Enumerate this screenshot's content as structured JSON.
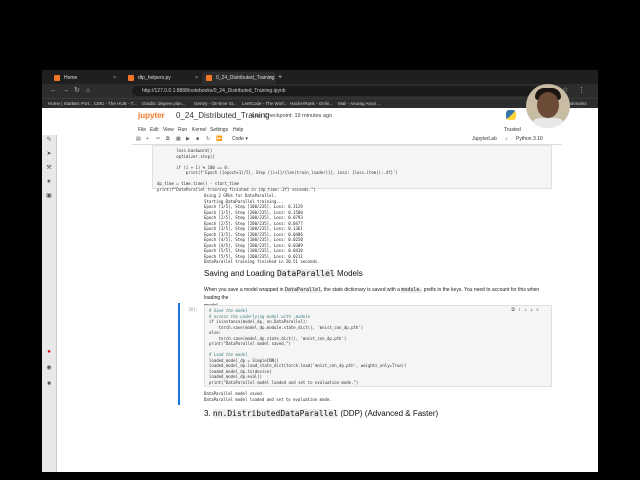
{
  "browser": {
    "tabs": [
      {
        "label": "Home",
        "color": "#f37726"
      },
      {
        "label": "dtp_helpers.py",
        "color": "#f37726"
      },
      {
        "label": "0_24_Distributed_Training",
        "color": "#f37726"
      }
    ],
    "new_tab_icon": "plus-icon",
    "url": "http://127.0.0.1:8888/notebooks/0_24_Distributed_Training.ipynb",
    "bookmarks": [
      "Home | StarBez Port...",
      "CMU - The HUB - T...",
      "Gradio: degree plan...",
      "Gentry - On-time St...",
      "LeetCode - The Worl...",
      "HackerRank - Onlin...",
      "Mail - Anurag Aryal ...",
      "All Bookmarks"
    ]
  },
  "jupyter": {
    "logo": "jupyter",
    "notebook_title": "0_24_Distributed_Training",
    "checkpoint": "Last Checkpoint: 19 minutes ago",
    "menu": [
      "File",
      "Edit",
      "View",
      "Run",
      "Kernel",
      "Settings",
      "Help"
    ],
    "trusted": "Trusted",
    "cell_type": "Code",
    "jupyterlab_link": "JupyterLab",
    "kernel": "Python 3.10 (ipykernel)"
  },
  "cells": {
    "code1": [
      "        loss.backward()",
      "        optimizer.step()",
      "",
      "        if (i + 1) % 100 == 0:",
      "            print(f'Epoch [{epoch+1}/5], Step [{i+1}/{len(train_loader)}], Loss: {loss.item():.4f}')",
      "",
      "dp_time = time.time() - start_time",
      "print(f\"DataParallel training finished in {dp_time:.2f} seconds.\")"
    ],
    "output1": [
      "Using 2 GPUs for DataParallel.",
      "Starting DataParallel training...",
      "Epoch [1/5], Step [100/235], Loss: 0.3129",
      "Epoch [1/5], Step [200/235], Loss: 0.1580",
      "Epoch [2/5], Step [100/235], Loss: 0.0793",
      "Epoch [2/5], Step [200/235], Loss: 0.0477",
      "Epoch [3/5], Step [100/235], Loss: 0.1361",
      "Epoch [3/5], Step [200/235], Loss: 0.0406",
      "Epoch [4/5], Step [100/235], Loss: 0.0250",
      "Epoch [4/5], Step [200/235], Loss: 0.0309",
      "Epoch [5/5], Step [100/235], Loss: 0.0410",
      "Epoch [5/5], Step [200/235], Loss: 0.0211",
      "DataParallel training finished in 20.51 seconds."
    ],
    "heading1_pre": "Saving and Loading ",
    "heading1_code": "DataParallel",
    "heading1_post": " Models",
    "md_p1_a": "When you save a model wrapped in ",
    "md_p1_code1": "DataParallel",
    "md_p1_b": ", the state dictionary is saved with a ",
    "md_p1_code2": "module.",
    "md_p1_c": " prefix in the keys. You need to account for this when loading the",
    "md_p1_d": "model.",
    "prompt2": "[8]:",
    "code2": [
      "# Save the model",
      "# access the underlying model with .module",
      "if isinstance(model_dp, nn.DataParallel):",
      "    torch.save(model_dp.module.state_dict(), 'mnist_cnn_dp.pth')",
      "else:",
      "    torch.save(model_dp.state_dict(), 'mnist_cnn_dp.pth')",
      "print(\"DataParallel model saved.\")",
      "",
      "# Load the model",
      "loaded_model_dp = SimpleCNN()",
      "loaded_model_dp.load_state_dict(torch.load('mnist_cnn_dp.pth', weights_only=True))",
      "loaded_model_dp.to(device)",
      "loaded_model_dp.eval()",
      "print(\"DataParallel model loaded and set to evaluation mode.\")"
    ],
    "output2": [
      "DataParallel model saved.",
      "DataParallel model loaded and set to evaluation mode."
    ],
    "heading2_pre": "3. ",
    "heading2_code": "nn.DistributedDataParallel",
    "heading2_post": " (DDP) (Advanced & Faster)"
  }
}
